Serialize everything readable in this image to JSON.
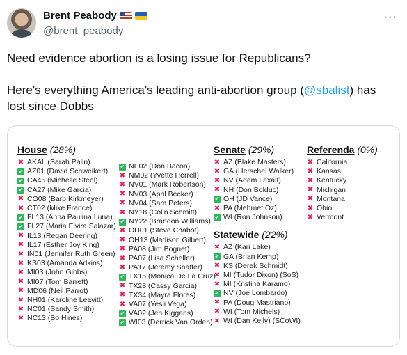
{
  "author": {
    "display_name": "Brent Peabody",
    "handle": "@brent_peabody",
    "flags": [
      "us-flag-icon",
      "ukraine-flag-icon"
    ]
  },
  "more_icon": "···",
  "tweet": {
    "line1": "Need evidence abortion is a losing issue for Republicans?",
    "line2_before": "Here's everything America's leading anti-abortion group (",
    "line2_mention": "@sbalist",
    "line2_after": ") has lost since Dobbs"
  },
  "colors": {
    "lost": "#e0245e",
    "won": "#2db85a",
    "link": "#1d9bf0"
  },
  "house": {
    "title": "House",
    "pct": "(28%)",
    "col1": [
      {
        "s": "x",
        "t": "AKAL (Sarah Palin)"
      },
      {
        "s": "c",
        "t": "AZ01 (David Schweikert)"
      },
      {
        "s": "c",
        "t": "CA45 (Michelle Steel)"
      },
      {
        "s": "c",
        "t": "CA27 (Mike Garcia)"
      },
      {
        "s": "x",
        "t": "CO08 (Barb Kirkmeyer)"
      },
      {
        "s": "x",
        "t": "CT02 (Mike France)"
      },
      {
        "s": "c",
        "t": "FL13 (Anna Paulina Luna)"
      },
      {
        "s": "c",
        "t": "FL27 (Maria Elvira Salazar)"
      },
      {
        "s": "x",
        "t": "IL13 (Regan Deering)"
      },
      {
        "s": "x",
        "t": "IL17 (Esther Joy King)"
      },
      {
        "s": "x",
        "t": "IN01 (Jennifer Ruth Green)"
      },
      {
        "s": "x",
        "t": "KS03 (Amanda Adkins)"
      },
      {
        "s": "x",
        "t": "MI03 (John Gibbs)"
      },
      {
        "s": "x",
        "t": "MI07 (Tom Barrett)"
      },
      {
        "s": "x",
        "t": "MD06 (Neil Parrot)"
      },
      {
        "s": "x",
        "t": "NH01 (Karoline Leavitt)"
      },
      {
        "s": "x",
        "t": "NC01 (Sandy Smith)"
      },
      {
        "s": "x",
        "t": "NC13 (Bo Hines)"
      }
    ],
    "col2": [
      {
        "s": "c",
        "t": "NE02 (Don Bacon)"
      },
      {
        "s": "x",
        "t": "NM02 (Yvette Herrell)"
      },
      {
        "s": "x",
        "t": "NV01 (Mark Robertson)"
      },
      {
        "s": "x",
        "t": "NV03 (April Becker)"
      },
      {
        "s": "x",
        "t": "NV04 (Sam Peters)"
      },
      {
        "s": "x",
        "t": "NY18 (Colin Schmitt)"
      },
      {
        "s": "c",
        "t": "NY22 (Brandon Williams)"
      },
      {
        "s": "x",
        "t": "OH01 (Steve Chabot)"
      },
      {
        "s": "x",
        "t": "OH13 (Madison Gilbert)"
      },
      {
        "s": "x",
        "t": "PA08 (Jim Bognet)"
      },
      {
        "s": "x",
        "t": "PA07 (Lisa Scheller)"
      },
      {
        "s": "x",
        "t": "PA17 (Jeremy Shaffer)"
      },
      {
        "s": "c",
        "t": "TX15 (Monica De La Cruz)"
      },
      {
        "s": "x",
        "t": "TX28 (Cassy Garcia)"
      },
      {
        "s": "x",
        "t": "TX34 (Mayra Flores)"
      },
      {
        "s": "x",
        "t": "VA07 (Yesli Vega)"
      },
      {
        "s": "c",
        "t": "VA02 (Jen Kiggans)"
      },
      {
        "s": "c",
        "t": "WI03 (Derrick Van Orden)"
      }
    ]
  },
  "senate": {
    "title": "Senate",
    "pct": "(29%)",
    "items": [
      {
        "s": "x",
        "t": "AZ (Blake Masters)"
      },
      {
        "s": "x",
        "t": "GA (Herschel Walker)"
      },
      {
        "s": "x",
        "t": "NV (Adam Laxalt)"
      },
      {
        "s": "x",
        "t": "NH (Don Bolduc)"
      },
      {
        "s": "c",
        "t": "OH (JD Vance)"
      },
      {
        "s": "x",
        "t": "PA (Mehmet Oz)"
      },
      {
        "s": "c",
        "t": "WI (Ron Johnson)"
      }
    ]
  },
  "statewide": {
    "title": "Statewide",
    "pct": "(22%)",
    "items": [
      {
        "s": "x",
        "t": "AZ (Kari Lake)"
      },
      {
        "s": "c",
        "t": "GA (Brian Kemp)"
      },
      {
        "s": "x",
        "t": "KS (Derek Schmidt)"
      },
      {
        "s": "x",
        "t": "MI (Tudor Dixon) (SoS)"
      },
      {
        "s": "x",
        "t": "MI (Kristina Karamo)"
      },
      {
        "s": "c",
        "t": "NV (Joe Lombardo)"
      },
      {
        "s": "x",
        "t": "PA (Doug Mastriano)"
      },
      {
        "s": "x",
        "t": "WI (Tom Michels)"
      },
      {
        "s": "x",
        "t": "WI (Dan Kelly) (SCoWI)"
      }
    ]
  },
  "referenda": {
    "title": "Referenda",
    "pct": "(0%)",
    "items": [
      {
        "s": "x",
        "t": "California"
      },
      {
        "s": "x",
        "t": "Kansas"
      },
      {
        "s": "x",
        "t": "Kentucky"
      },
      {
        "s": "x",
        "t": "Michigan"
      },
      {
        "s": "x",
        "t": "Montana"
      },
      {
        "s": "x",
        "t": "Ohio"
      },
      {
        "s": "x",
        "t": "Vermont"
      }
    ]
  }
}
